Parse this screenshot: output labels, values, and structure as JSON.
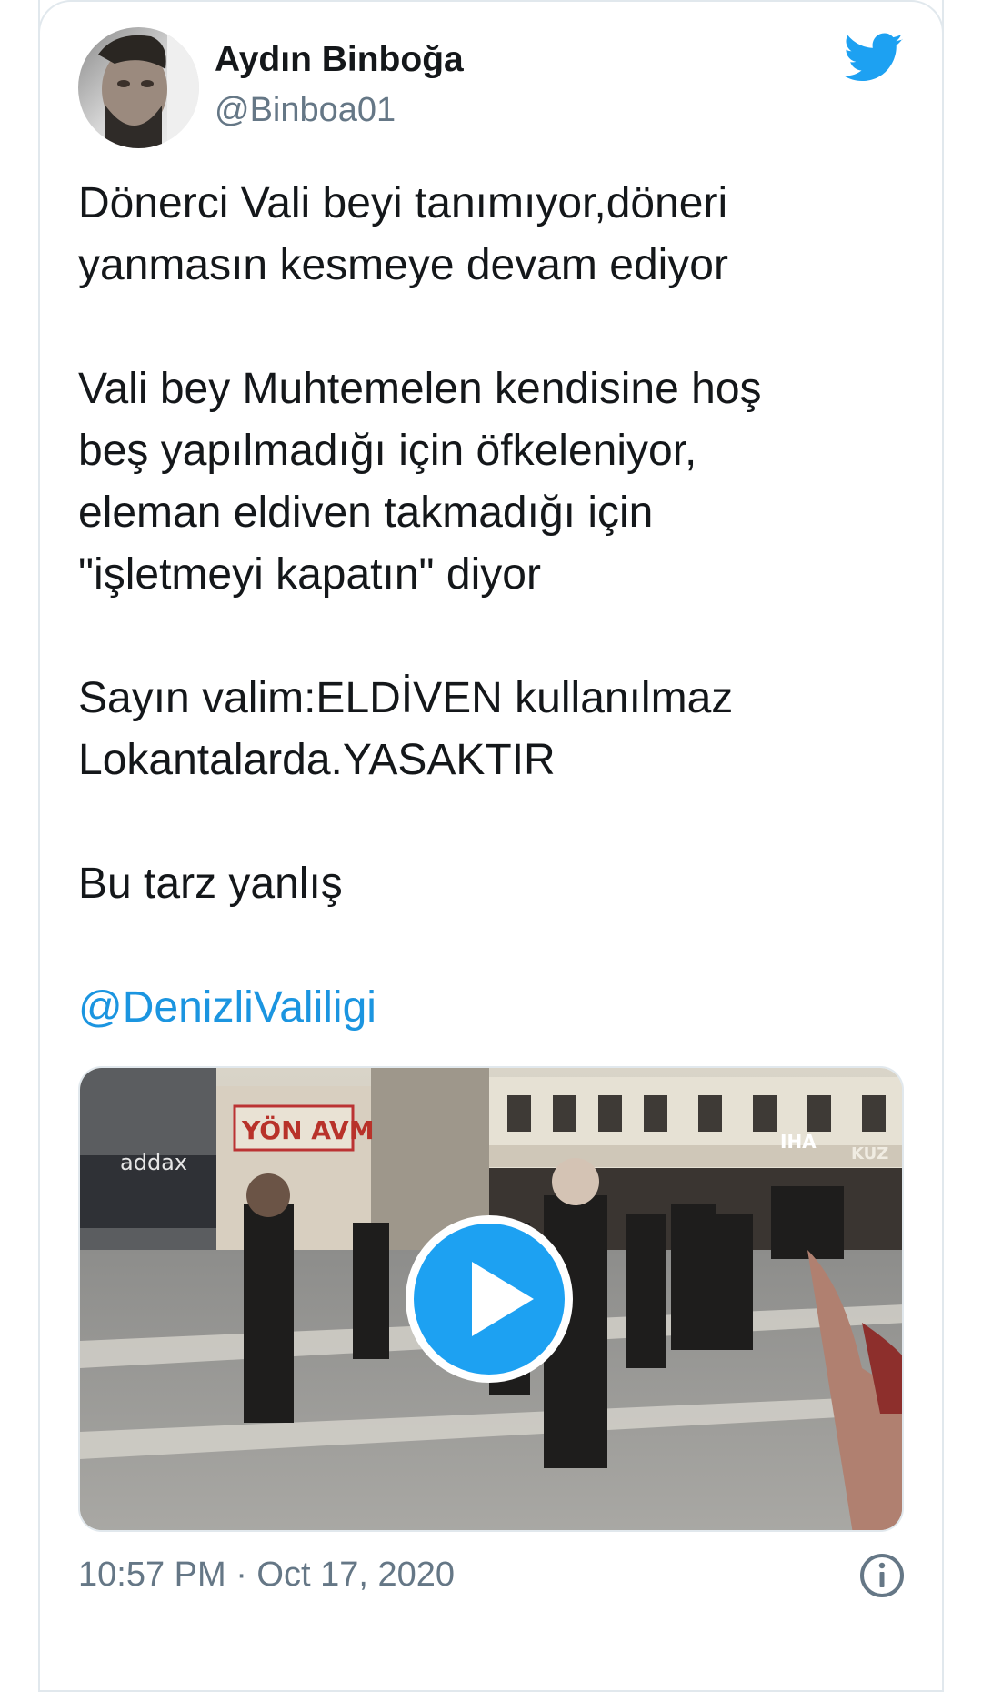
{
  "author": {
    "name": "Aydın Binboğa",
    "handle": "@Binboa01"
  },
  "tweet": {
    "paragraphs": [
      "Dönerci Vali beyi tanımıyor,döneri\nyanmasın kesmeye devam ediyor",
      "Vali bey Muhtemelen kendisine hoş\nbeş yapılmadığı için öfkeleniyor,\neleman eldiven takmadığı için\n\"işletmeyi kapatın\" diyor",
      "Sayın valim:ELDİVEN kullanılmaz\nLokantalarda.YASAKTIR",
      "Bu tarz yanlış"
    ],
    "mention": "@DenizliValiligi"
  },
  "media": {
    "type": "video",
    "watermark": "IHA",
    "shop_signs": [
      "YÖN AVM",
      "addax",
      "KUZ"
    ]
  },
  "footer": {
    "timestamp": "10:57 PM · Oct 17, 2020"
  },
  "icons": {
    "brand": "twitter-bird-icon",
    "play": "play-icon",
    "info": "info-icon"
  },
  "colors": {
    "twitter_blue": "#1da1f2",
    "link_blue": "#1b95e0",
    "text": "#14171a",
    "secondary": "#657786",
    "border": "#e1e8ed"
  }
}
